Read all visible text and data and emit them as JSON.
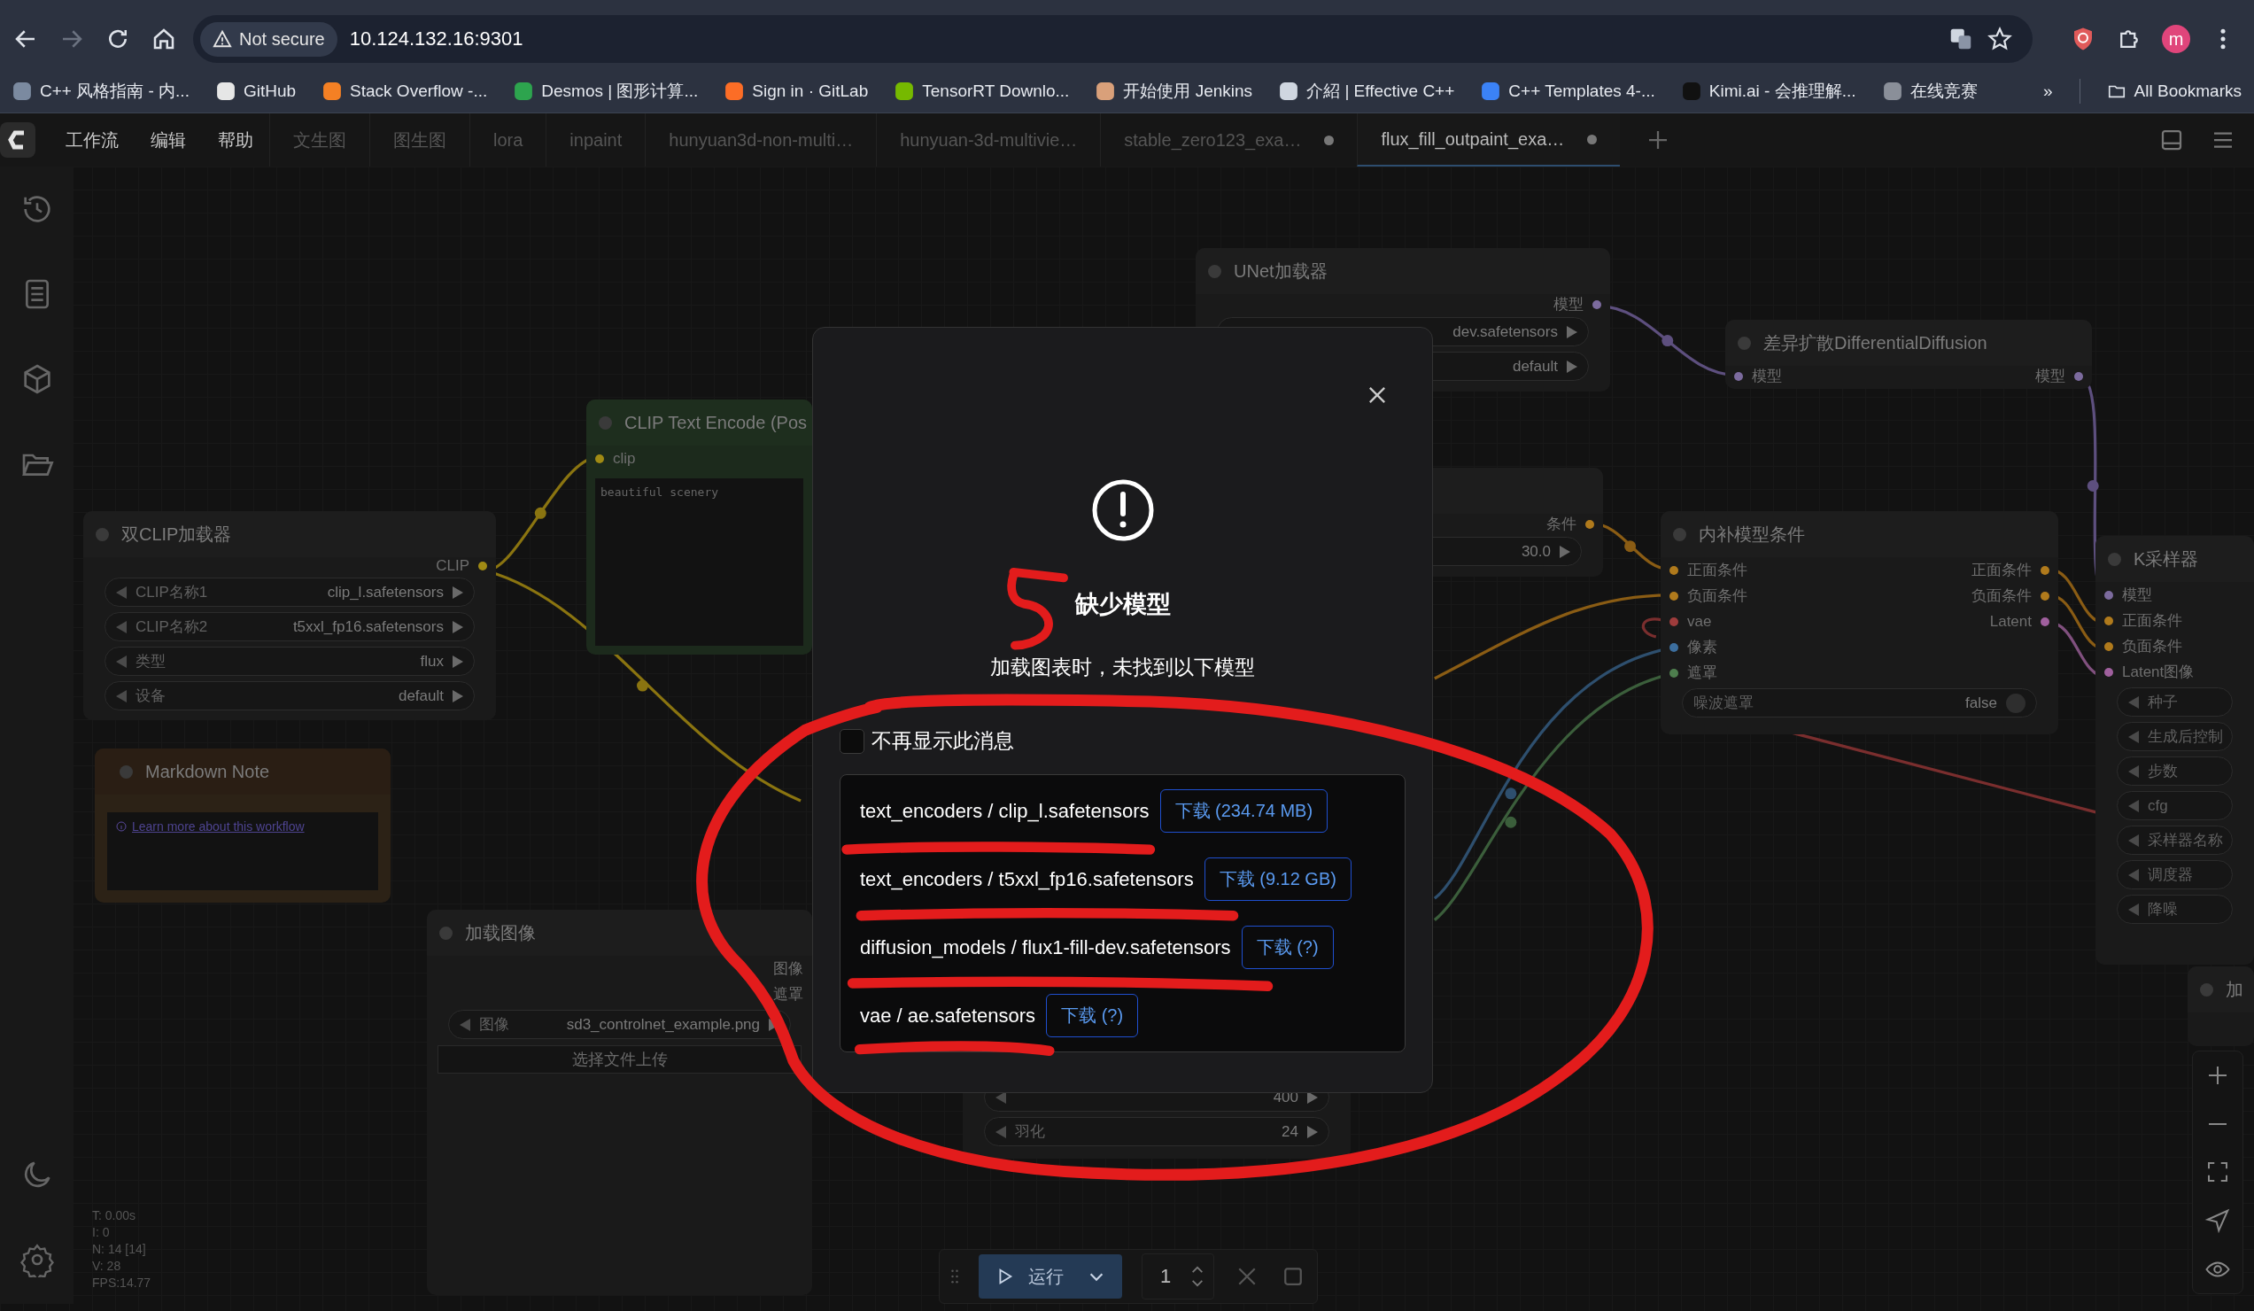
{
  "browser": {
    "security_label": "Not secure",
    "url": "10.124.132.16:9301",
    "profile_initial": "m",
    "bookmarks": [
      {
        "label": "C++ 风格指南 - 内..."
      },
      {
        "label": "GitHub"
      },
      {
        "label": "Stack Overflow -..."
      },
      {
        "label": "Desmos | 图形计算..."
      },
      {
        "label": "Sign in · GitLab"
      },
      {
        "label": "TensorRT Downlo..."
      },
      {
        "label": "开始使用 Jenkins"
      },
      {
        "label": "介紹 | Effective C++"
      },
      {
        "label": "C++ Templates 4-..."
      },
      {
        "label": "Kimi.ai - 会推理解..."
      },
      {
        "label": "在线竞赛"
      }
    ],
    "overflow": "»",
    "all_bookmarks": "All Bookmarks"
  },
  "app": {
    "menus": [
      "工作流",
      "编辑",
      "帮助"
    ],
    "tabs": [
      {
        "label": "文生图",
        "selected": false,
        "unsaved": false
      },
      {
        "label": "图生图",
        "selected": false,
        "unsaved": false
      },
      {
        "label": "lora",
        "selected": false,
        "unsaved": false
      },
      {
        "label": "inpaint",
        "selected": false,
        "unsaved": false
      },
      {
        "label": "hunyuan3d-non-multi…",
        "selected": false,
        "unsaved": false
      },
      {
        "label": "hunyuan-3d-multivie…",
        "selected": false,
        "unsaved": false
      },
      {
        "label": "stable_zero123_exa…",
        "selected": false,
        "unsaved": true
      },
      {
        "label": "flux_fill_outpaint_exa…",
        "selected": true,
        "unsaved": true
      }
    ]
  },
  "canvas": {
    "nodes": [
      {
        "kind": "standard",
        "title": "UNet加载器",
        "outputs": [
          {
            "label": "模型",
            "color": "#7c6b9e"
          }
        ],
        "widgets": [
          {
            "kind": "right",
            "value": "dev.safetensors"
          },
          {
            "kind": "right",
            "value": "default"
          }
        ]
      },
      {
        "kind": "prompt",
        "title": "CLIP Text Encode (Pos",
        "inputs": [
          {
            "label": "clip",
            "color": "#a08a14"
          }
        ],
        "text": "beautiful scenery"
      },
      {
        "kind": "standard",
        "title": "双CLIP加载器",
        "outputs": [
          {
            "label": "CLIP",
            "color": "#a08a14"
          }
        ],
        "widgets": [
          {
            "kind": "combo",
            "label": "CLIP名称1",
            "value": "clip_l.safetensors"
          },
          {
            "kind": "combo",
            "label": "CLIP名称2",
            "value": "t5xxl_fp16.safetensors"
          },
          {
            "kind": "combo",
            "label": "类型",
            "value": "flux"
          },
          {
            "kind": "combo",
            "label": "设备",
            "value": "default"
          }
        ]
      },
      {
        "kind": "standard",
        "outputs": [
          {
            "label": "条件",
            "color": "#b07a1c"
          }
        ],
        "widgets": [
          {
            "kind": "right",
            "value": "30.0"
          }
        ]
      },
      {
        "kind": "standard",
        "title": "差异扩散DifferentialDiffusion",
        "inputs": [
          {
            "label": "模型",
            "color": "#7c6b9e"
          }
        ],
        "outputs": [
          {
            "label": "模型",
            "color": "#7c6b9e"
          }
        ]
      },
      {
        "kind": "standard",
        "title": "内补模型条件",
        "inputs": [
          {
            "label": "正面条件",
            "color": "#b07a1c"
          },
          {
            "label": "负面条件",
            "color": "#b07a1c"
          },
          {
            "label": "vae",
            "color": "#9e3c3c"
          },
          {
            "label": "像素",
            "color": "#3c6e9e"
          },
          {
            "label": "遮罩",
            "color": "#4e7e4e"
          }
        ],
        "outputs": [
          {
            "label": "正面条件",
            "color": "#b07a1c"
          },
          {
            "label": "负面条件",
            "color": "#b07a1c"
          },
          {
            "label": "Latent",
            "color": "#a0609e"
          }
        ],
        "widgets": [
          {
            "kind": "toggle",
            "label": "噪波遮罩",
            "value": "false"
          }
        ]
      },
      {
        "kind": "standard",
        "title": "K采样器",
        "inputs": [
          {
            "label": "模型",
            "color": "#7c6b9e"
          },
          {
            "label": "正面条件",
            "color": "#b07a1c"
          },
          {
            "label": "负面条件",
            "color": "#b07a1c"
          },
          {
            "label": "Latent图像",
            "color": "#a0609e"
          }
        ],
        "widgets": [
          {
            "kind": "left",
            "label": "种子"
          },
          {
            "kind": "left",
            "label": "生成后控制"
          },
          {
            "kind": "left",
            "label": "步数"
          },
          {
            "kind": "left",
            "label": "cfg"
          },
          {
            "kind": "left",
            "label": "采样器名称"
          },
          {
            "kind": "left",
            "label": "调度器"
          },
          {
            "kind": "left",
            "label": "降噪"
          }
        ]
      },
      {
        "kind": "note",
        "title": "Markdown Note",
        "link": "Learn more about this workflow"
      },
      {
        "kind": "standard",
        "title": "加载图像",
        "outputs": [
          {
            "label": "图像"
          },
          {
            "label": "遮罩"
          }
        ],
        "widgets": [
          {
            "kind": "combo",
            "label": "图像",
            "value": "sd3_controlnet_example.png"
          }
        ],
        "button": "选择文件上传"
      },
      {
        "kind": "headless",
        "widgets": [
          {
            "kind": "combo",
            "value": "400"
          },
          {
            "kind": "combo",
            "label": "羽化",
            "value": "24"
          }
        ]
      },
      {
        "kind": "standard",
        "title": "加"
      }
    ],
    "stats": [
      "T: 0.00s",
      "I: 0",
      "N: 14 [14]",
      "V: 28",
      "FPS:14.77"
    ]
  },
  "run_toolbar": {
    "run_label": "运行",
    "count": "1"
  },
  "dialog": {
    "title": "缺少模型",
    "message": "加载图表时，未找到以下模型",
    "dont_show_again": {
      "label": "不再显示此消息",
      "checked": false
    },
    "models": [
      {
        "name": "text_encoders / clip_l.safetensors",
        "download": "下载 (234.74 MB)"
      },
      {
        "name": "text_encoders / t5xxl_fp16.safetensors",
        "download": "下载 (9.12 GB)"
      },
      {
        "name": "diffusion_models / flux1-fill-dev.safetensors",
        "download": "下载 (?)"
      },
      {
        "name": "vae / ae.safetensors",
        "download": "下载 (?)"
      }
    ]
  }
}
